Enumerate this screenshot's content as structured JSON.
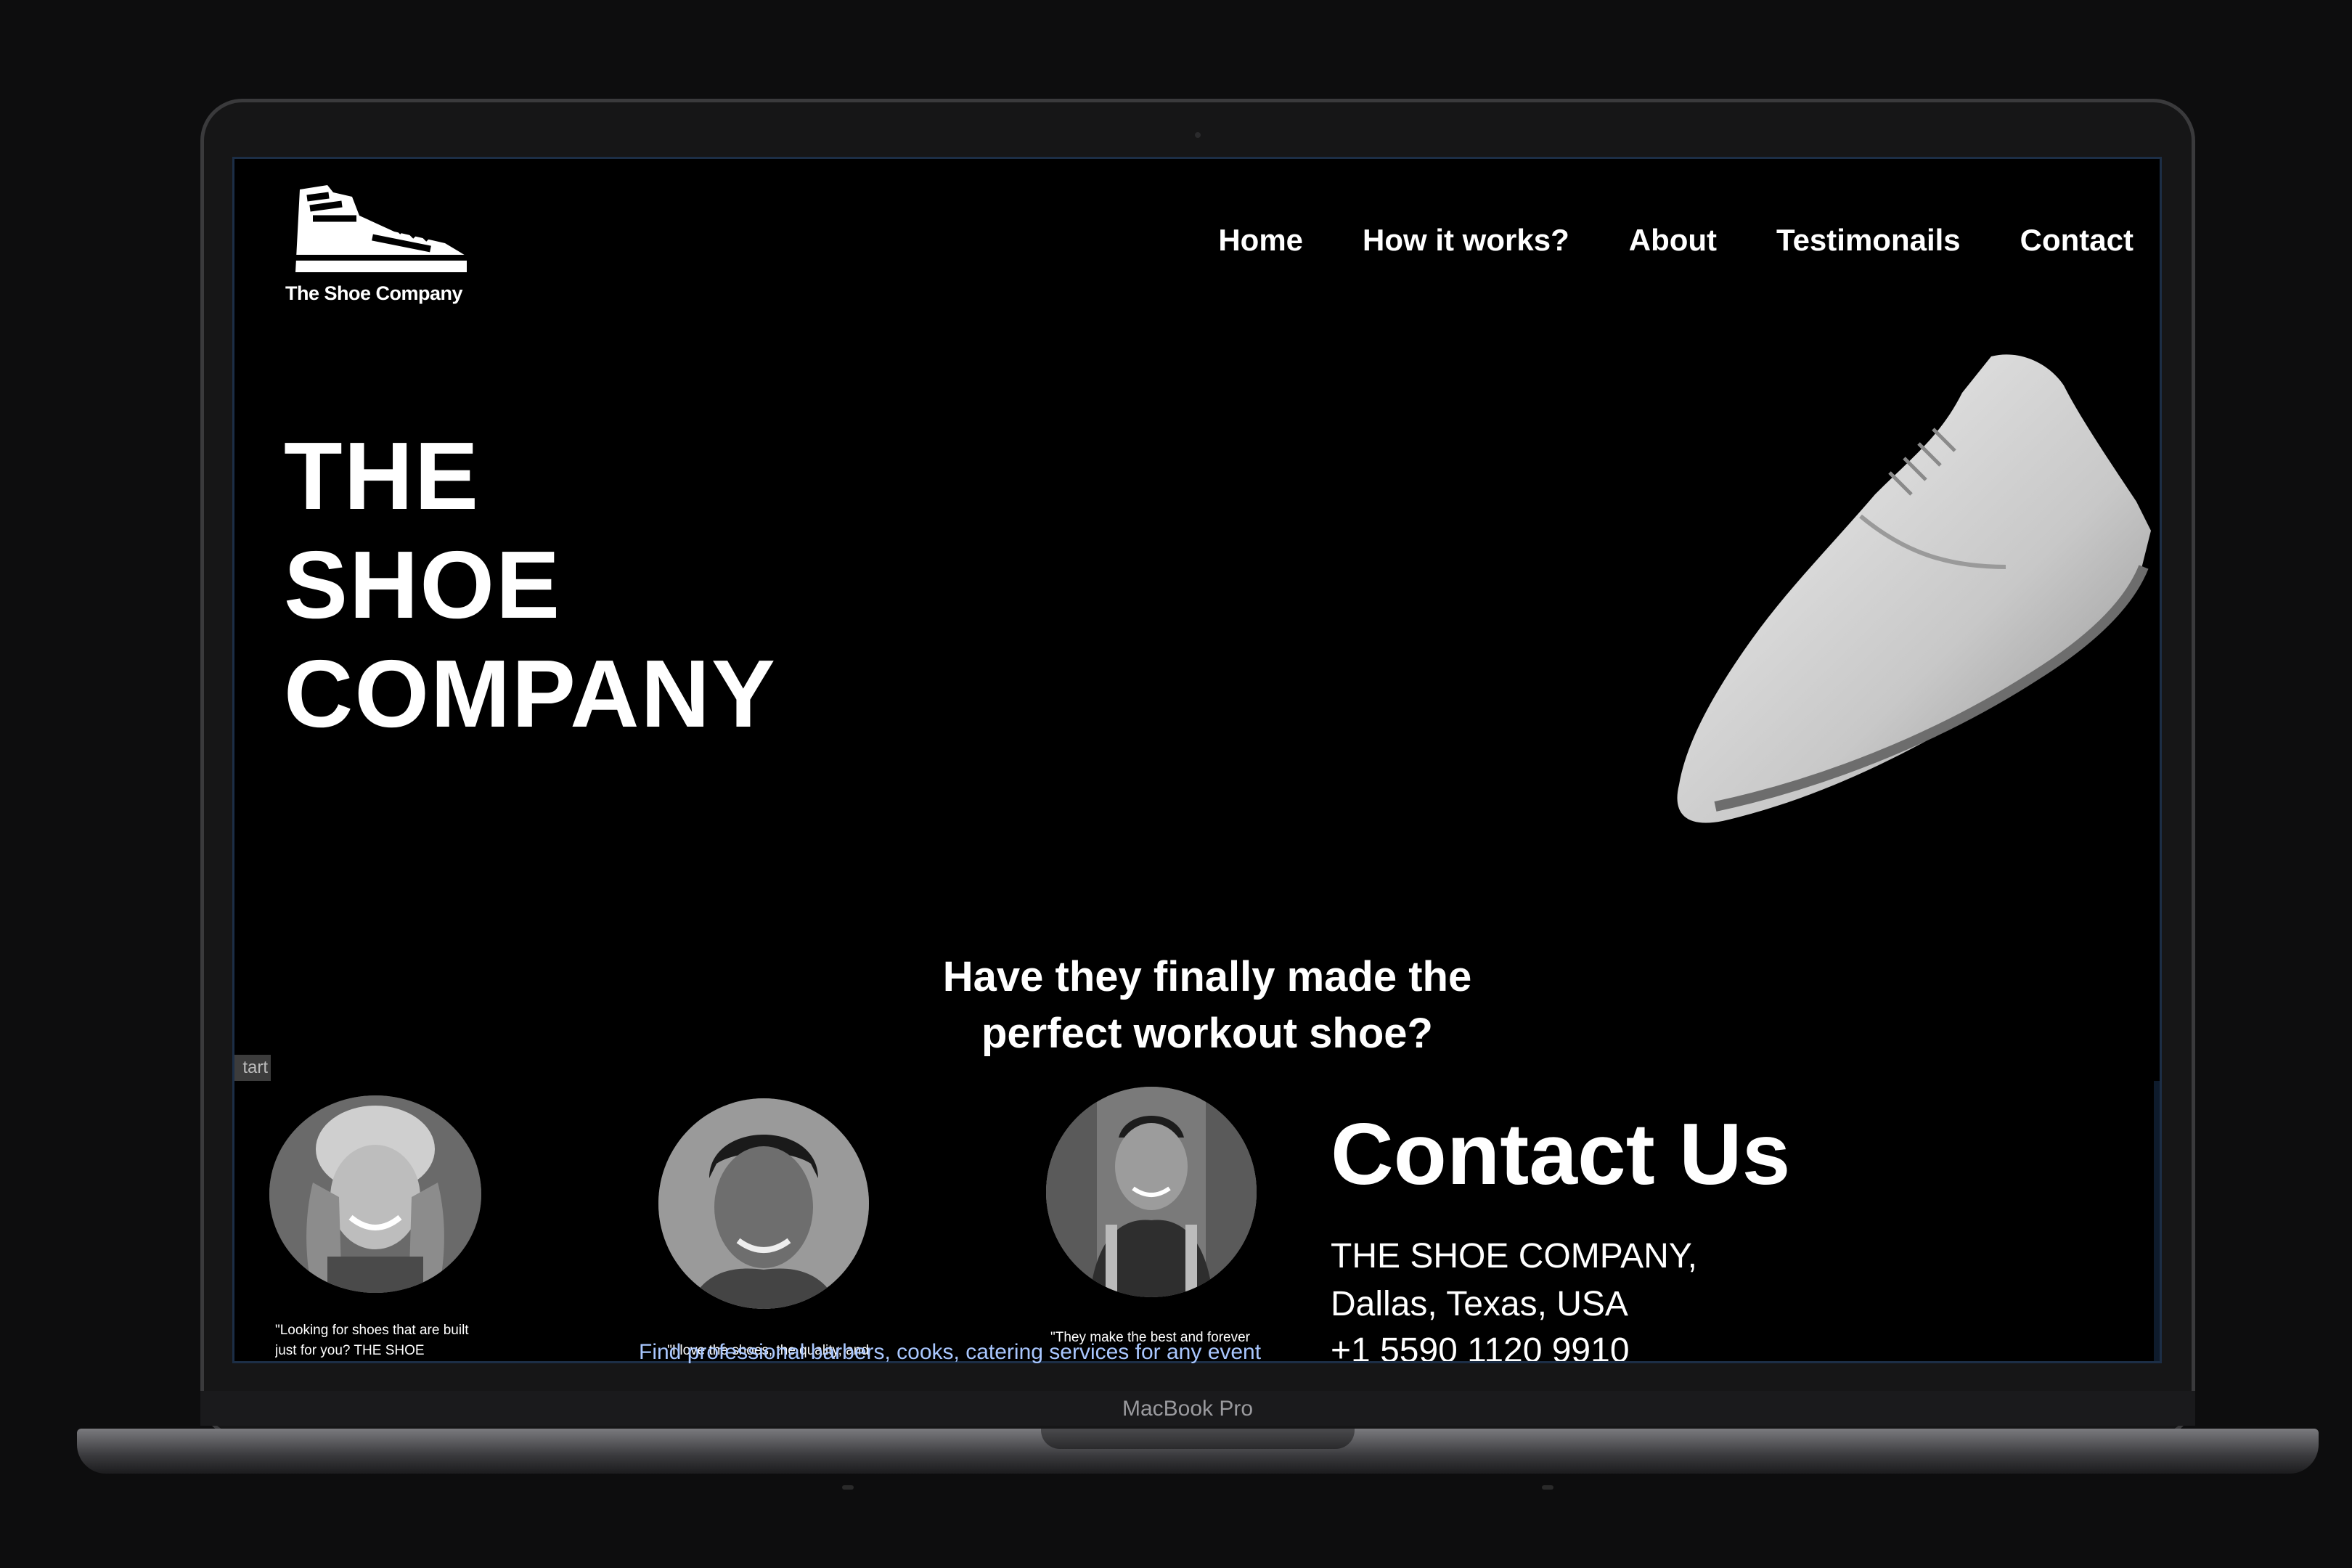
{
  "site": {
    "logo_text": "The Shoe Company",
    "nav": [
      "Home",
      "How it works?",
      "About",
      "Testimonails",
      "Contact"
    ],
    "hero_title": [
      "THE",
      "SHOE",
      "COMPANY"
    ],
    "tagline": [
      "Have they finally made the",
      "perfect workout shoe?"
    ],
    "start_tab": "tart",
    "testimonials": [
      {
        "quote": "\"Looking for shoes that are built just for you? THE SHOE"
      },
      {
        "quote": "\"I love the shoes, the quality, and"
      },
      {
        "quote": "\"They make the best and forever"
      }
    ],
    "overflow_text": "Find professional barbers, cooks, catering services for any event",
    "contact": {
      "title": "Contact Us",
      "name": "THE SHOE COMPANY,",
      "location": "Dallas, Texas, USA",
      "phone": "+1 5590 1120 9910"
    }
  },
  "device": {
    "label": "MacBook Pro"
  },
  "colors": {
    "page_bg": "#000000",
    "text": "#ffffff",
    "frame_bg": "#0d0d0e"
  },
  "icons": {
    "logo": "sneaker-logo-icon"
  }
}
